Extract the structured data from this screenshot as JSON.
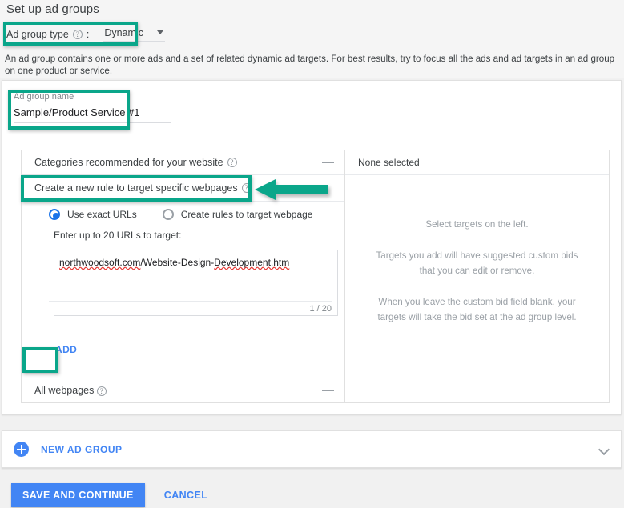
{
  "header": {
    "title": "Set up ad groups",
    "type_label": "Ad group type",
    "colon": ":",
    "help_icon": "help-icon",
    "type_value": "Dynamic",
    "description": "An ad group contains one or more ads and a set of related dynamic ad targets. For best results, try to focus all the ads and ad targets in an ad group on one product or service."
  },
  "ad_group": {
    "name_label": "Ad group name",
    "name_value": "Sample/Product Service #1"
  },
  "targeting": {
    "categories_row": "Categories recommended for your website",
    "rule_row": "Create a new rule to target specific webpages",
    "radio_exact": "Use exact URLs",
    "radio_rules": "Create rules to target webpage",
    "urls_label": "Enter up to 20 URLs to target:",
    "url_value_domain": "northwoodsoft.com",
    "url_value_path": "/Website-Design-",
    "url_value_tail": "Development.htm",
    "url_count": "1 / 20",
    "add_label": "ADD",
    "all_webpages_row": "All webpages"
  },
  "selected_panel": {
    "none_selected": "None selected",
    "line1": "Select targets on the left.",
    "line2": "Targets you add will have suggested custom bids that you can edit or remove.",
    "line3": "When you leave the custom bid field blank, your targets will take the bid set at the ad group level."
  },
  "new_ad_group": {
    "label": "NEW AD GROUP",
    "plus_icon": "circle-plus-icon",
    "chevron_icon": "chevron-down-icon"
  },
  "footer": {
    "save_label": "SAVE AND CONTINUE",
    "cancel_label": "CANCEL"
  },
  "annotations": {
    "highlight_color": "#0aa68a",
    "arrow_color": "#0aa68a",
    "arrow_direction": "left"
  },
  "colors": {
    "accent_blue": "#4285f4",
    "radio_blue": "#1a73e8",
    "page_bg": "#f1f1f1",
    "top_bg": "#f5f5f5",
    "text": "#3c4043",
    "muted": "#9aa0a6"
  }
}
